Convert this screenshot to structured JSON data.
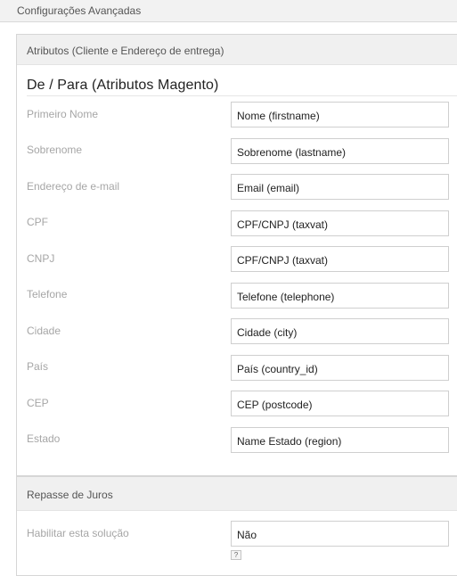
{
  "header": {
    "title": "Configurações Avançadas"
  },
  "attributes_panel": {
    "title": "Atributos (Cliente e Endereço de entrega)",
    "section_title": "De / Para (Atributos Magento)",
    "rows": [
      {
        "label": "Primeiro Nome",
        "value": "Nome (firstname)"
      },
      {
        "label": "Sobrenome",
        "value": "Sobrenome (lastname)"
      },
      {
        "label": "Endereço de e-mail",
        "value": "Email (email)"
      },
      {
        "label": "CPF",
        "value": "CPF/CNPJ (taxvat)"
      },
      {
        "label": "CNPJ",
        "value": "CPF/CNPJ (taxvat)"
      },
      {
        "label": "Telefone",
        "value": "Telefone (telephone)"
      },
      {
        "label": "Cidade",
        "value": "Cidade (city)"
      },
      {
        "label": "País",
        "value": "País (country_id)"
      },
      {
        "label": "CEP",
        "value": "CEP (postcode)"
      },
      {
        "label": "Estado",
        "value": "Name Estado (region)"
      }
    ]
  },
  "juros_panel": {
    "title": "Repasse de Juros",
    "enable_label": "Habilitar esta solução",
    "enable_value": "Não",
    "help_icon": "?"
  }
}
